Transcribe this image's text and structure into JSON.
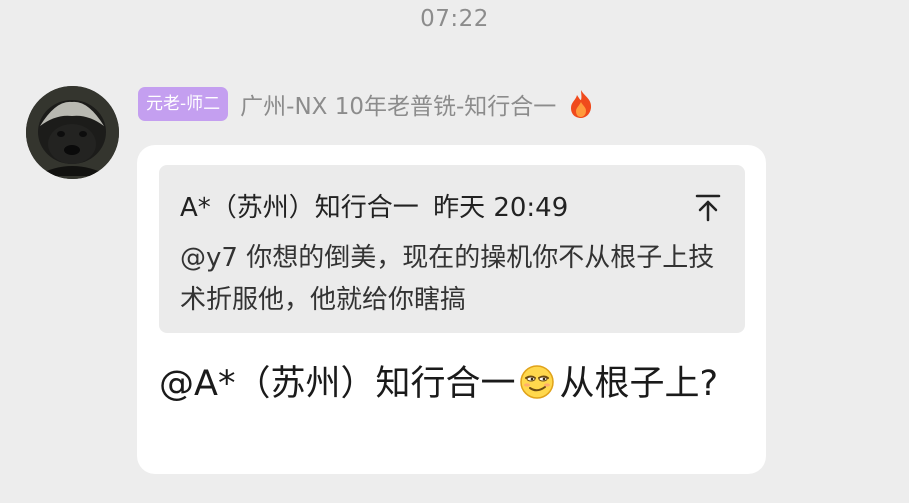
{
  "time_divider": "07:22",
  "sender": {
    "role_badge": "元老-师二",
    "name": "广州-NX 10年老普铣-知行合一",
    "badge_color": "#c49ff0",
    "flair_icon": "fire-icon"
  },
  "quote": {
    "author": "A*（苏州）知行合一",
    "time": "昨天 20:49",
    "text": "@y7 你想的倒美，现在的操机你不从根子上技术折服他，他就给你瞎搞",
    "jump_icon": "arrow-up-bar-icon"
  },
  "message": {
    "mention": "@A*（苏州）知行合一",
    "emoji": "smirk-emoji",
    "text": "从根子上?"
  }
}
